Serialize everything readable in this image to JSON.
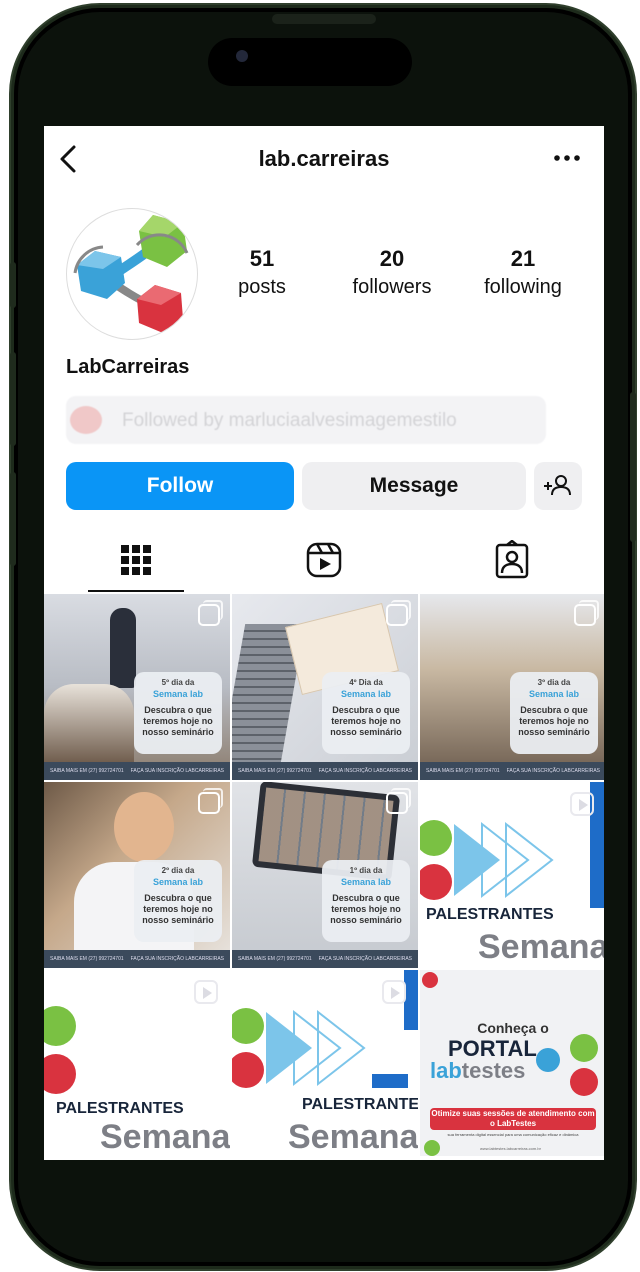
{
  "header": {
    "title": "lab.carreiras"
  },
  "profile": {
    "display_name": "LabCarreiras",
    "stats": {
      "posts": {
        "count": "51",
        "label": "posts"
      },
      "followers": {
        "count": "20",
        "label": "followers"
      },
      "following": {
        "count": "21",
        "label": "following"
      }
    },
    "followed_by": "Followed by marluciaalvesimagemestilo"
  },
  "actions": {
    "follow_label": "Follow",
    "message_label": "Message"
  },
  "colors": {
    "follow_blue": "#0a95f6",
    "secondary_button": "#efeff1",
    "brand_green": "#7ac143",
    "brand_blue": "#3aa2d8",
    "brand_red": "#d9333f"
  },
  "posts": [
    {
      "day": "5º dia da",
      "brand": "Semana lab",
      "text": "Descubra o que teremos hoje no nosso seminário",
      "footer_left": "SAIBA MAIS EM (27) 992724701",
      "footer_right": "FAÇA SUA INSCRIÇÃO LABCARREIRAS"
    },
    {
      "day": "4º Dia da",
      "brand": "Semana lab",
      "text": "Descubra o que teremos hoje no nosso seminário",
      "footer_left": "SAIBA MAIS EM (27) 992724701",
      "footer_right": "FAÇA SUA INSCRIÇÃO LABCARREIRAS"
    },
    {
      "day": "3º dia da",
      "brand": "Semana lab",
      "text": "Descubra o que teremos hoje no nosso seminário",
      "footer_left": "SAIBA MAIS EM (27) 992724701",
      "footer_right": "FAÇA SUA INSCRIÇÃO LABCARREIRAS"
    },
    {
      "day": "2º dia da",
      "brand": "Semana lab",
      "text": "Descubra o que teremos hoje no nosso seminário",
      "footer_left": "SAIBA MAIS EM (27) 992724701",
      "footer_right": "FAÇA SUA INSCRIÇÃO LABCARREIRAS"
    },
    {
      "day": "1º dia da",
      "brand": "Semana lab",
      "text": "Descubra o que teremos hoje no nosso seminário",
      "footer_left": "SAIBA MAIS EM (27) 992724701",
      "footer_right": "FAÇA SUA INSCRIÇÃO LABCARREIRAS"
    }
  ],
  "reels": {
    "palestrantes": "PALESTRANTES",
    "semana": "Semana",
    "portal_intro": "Conheça o",
    "portal_title": "PORTAL",
    "portal_brand_lab": "lab",
    "portal_brand_testes": "testes",
    "portal_cta": "Otimize suas sessões de atendimento com o LabTestes",
    "portal_sub": "sua ferramenta digital essencial para uma comunicação eficaz e dinâmica",
    "portal_url": "www.labtestes.labcarreiras.com.br"
  }
}
